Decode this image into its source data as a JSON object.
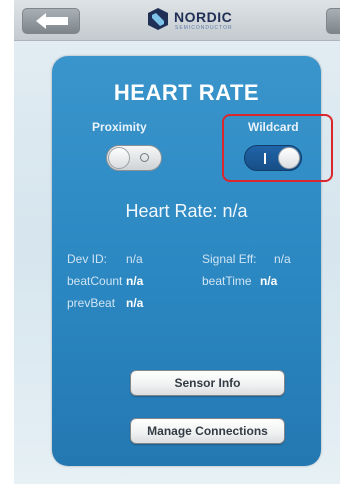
{
  "header": {
    "brand": "NORDIC",
    "brand_sub": "SEMICONDUCTOR",
    "icons": {
      "back": "arrow-left-icon",
      "logo": "nordic-logo-icon"
    }
  },
  "panel": {
    "title": "HEART RATE",
    "proximity": {
      "label": "Proximity",
      "enabled": false,
      "icon": "circle-off-icon"
    },
    "wildcard": {
      "label": "Wildcard",
      "enabled": true,
      "icon": "bar-on-icon"
    },
    "heart_rate": "Heart Rate: n/a",
    "fields": {
      "dev_id_label": "Dev ID:",
      "dev_id_value": "n/a",
      "signal_eff_label": "Signal Eff:",
      "signal_eff_value": "n/a",
      "beat_count_label": "beatCount",
      "beat_count_value": "n/a",
      "beat_time_label": "beatTime",
      "beat_time_value": "n/a",
      "prev_beat_label": "prevBeat",
      "prev_beat_value": "n/a"
    },
    "buttons": {
      "sensor_info": "Sensor Info",
      "manage_connections": "Manage Connections"
    }
  },
  "colors": {
    "panel": "#2b87c1",
    "toggle_on": "#1f64a9",
    "highlight": "#d9272e"
  }
}
